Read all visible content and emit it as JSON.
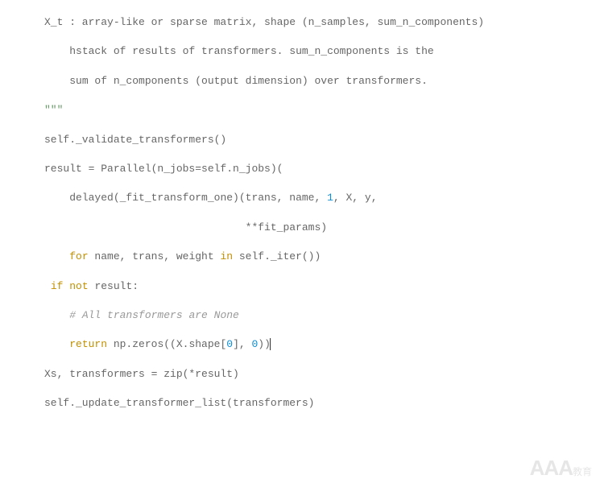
{
  "code": {
    "lines": [
      {
        "indent": "",
        "segments": [
          {
            "t": "X_t : array-like or sparse matrix, shape (n_samples, sum_n_components)",
            "c": "ident"
          }
        ]
      },
      {
        "blank": true
      },
      {
        "indent": "    ",
        "segments": [
          {
            "t": "hstack of results of transformers. sum_n_components is the",
            "c": "ident"
          }
        ]
      },
      {
        "blank": true
      },
      {
        "indent": "    ",
        "segments": [
          {
            "t": "sum of n_components (output dimension) over transformers.",
            "c": "ident"
          }
        ]
      },
      {
        "blank": true
      },
      {
        "indent": "",
        "segments": [
          {
            "t": "\"\"\"",
            "c": "str"
          }
        ]
      },
      {
        "blank": true
      },
      {
        "indent": "",
        "segments": [
          {
            "t": "self._validate_transformers()",
            "c": "ident"
          }
        ]
      },
      {
        "blank": true
      },
      {
        "indent": "",
        "segments": [
          {
            "t": "result = Parallel(n_jobs=self.n_jobs)(",
            "c": "ident"
          }
        ]
      },
      {
        "blank": true
      },
      {
        "indent": "    ",
        "segments": [
          {
            "t": "delayed(_fit_transform_one)(trans, name, ",
            "c": "ident"
          },
          {
            "t": "1",
            "c": "num"
          },
          {
            "t": ", X, y,",
            "c": "ident"
          }
        ]
      },
      {
        "blank": true
      },
      {
        "indent": "                                ",
        "segments": [
          {
            "t": "**fit_params)",
            "c": "ident"
          }
        ]
      },
      {
        "blank": true
      },
      {
        "indent": "    ",
        "segments": [
          {
            "t": "for",
            "c": "kw"
          },
          {
            "t": " name, trans, weight ",
            "c": "ident"
          },
          {
            "t": "in",
            "c": "kw"
          },
          {
            "t": " self._iter())",
            "c": "ident"
          }
        ]
      },
      {
        "blank": true
      },
      {
        "indent": " ",
        "segments": [
          {
            "t": "if",
            "c": "kw"
          },
          {
            "t": " ",
            "c": "ident"
          },
          {
            "t": "not",
            "c": "kw"
          },
          {
            "t": " result:",
            "c": "ident"
          }
        ]
      },
      {
        "blank": true
      },
      {
        "indent": "    ",
        "segments": [
          {
            "t": "# All transformers are None",
            "c": "comment"
          }
        ]
      },
      {
        "blank": true
      },
      {
        "indent": "    ",
        "segments": [
          {
            "t": "return",
            "c": "kw"
          },
          {
            "t": " np.zeros((X.shape[",
            "c": "ident"
          },
          {
            "t": "0",
            "c": "num"
          },
          {
            "t": "], ",
            "c": "ident"
          },
          {
            "t": "0",
            "c": "num"
          },
          {
            "t": "))",
            "c": "ident"
          }
        ],
        "cursor": true
      },
      {
        "blank": true
      },
      {
        "indent": "",
        "segments": [
          {
            "t": "Xs, transformers = zip(*result)",
            "c": "ident"
          }
        ]
      },
      {
        "blank": true
      },
      {
        "indent": "",
        "segments": [
          {
            "t": "self._update_transformer_list(transformers)",
            "c": "ident"
          }
        ]
      }
    ]
  },
  "watermark": {
    "main": "AAA",
    "sub": "教育"
  }
}
